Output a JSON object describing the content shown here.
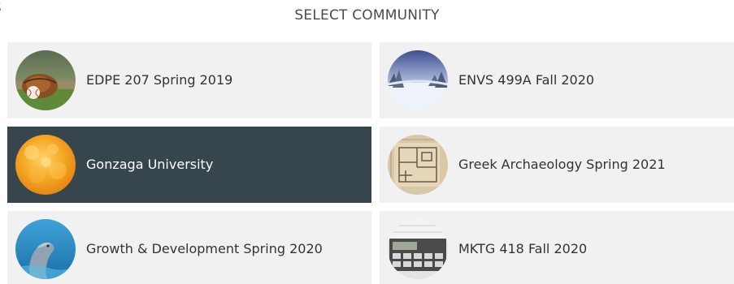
{
  "page": {
    "corner_text": "g",
    "title": "SELECT COMMUNITY"
  },
  "communities": [
    {
      "label": "EDPE 207 Spring 2019",
      "icon": "baseball-glove-icon",
      "selected": false
    },
    {
      "label": "ENVS 499A Fall 2020",
      "icon": "snowy-forest-icon",
      "selected": false
    },
    {
      "label": "Gonzaga University",
      "icon": "orange-bokeh-icon",
      "selected": true
    },
    {
      "label": "Greek Archaeology Spring 2021",
      "icon": "floor-plan-icon",
      "selected": false
    },
    {
      "label": "Growth & Development Spring 2020",
      "icon": "dolphin-icon",
      "selected": false
    },
    {
      "label": "MKTG 418 Fall 2020",
      "icon": "calculator-icon",
      "selected": false
    }
  ],
  "colors": {
    "card_bg": "#f1f1f1",
    "card_active_bg": "#37454d",
    "text": "#333333",
    "active_text": "#ffffff"
  }
}
